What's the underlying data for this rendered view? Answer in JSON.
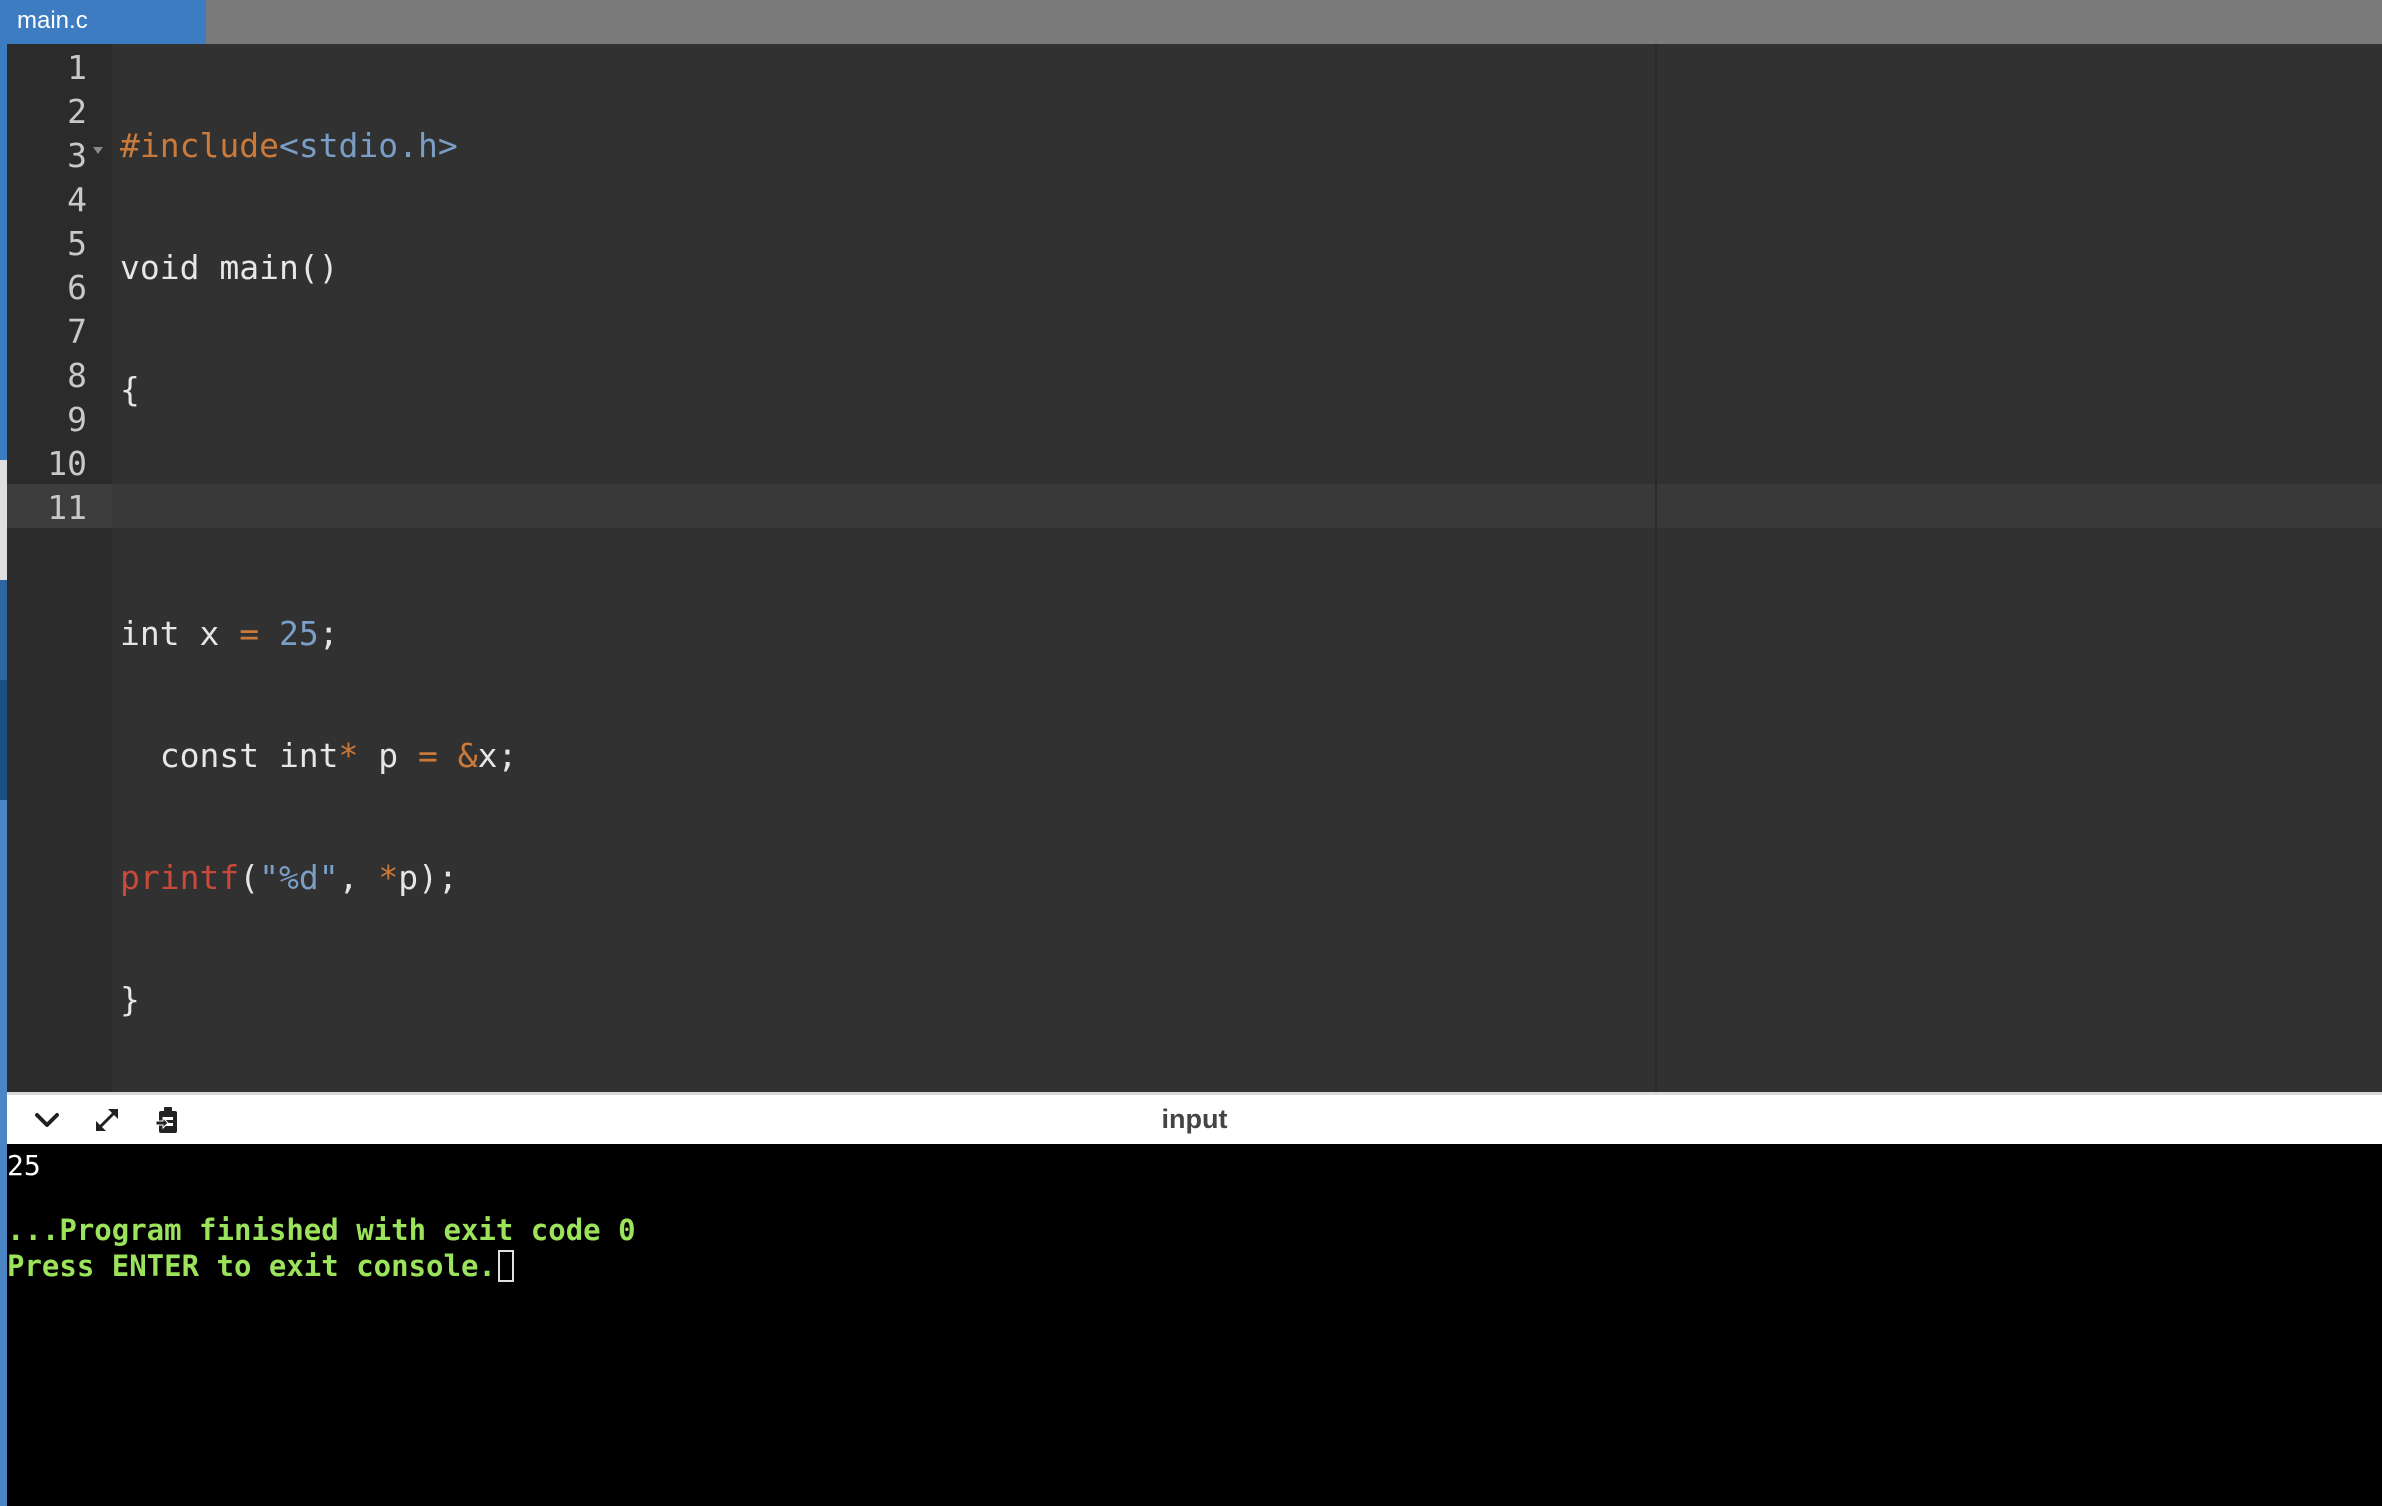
{
  "tabs": [
    {
      "label": "main.c",
      "active": true
    }
  ],
  "editor": {
    "line_numbers": [
      "1",
      "2",
      "3",
      "4",
      "5",
      "6",
      "7",
      "8",
      "9",
      "10",
      "11"
    ],
    "active_line": 11,
    "folded_line": 3
  },
  "code": {
    "l1": {
      "directive": "#include",
      "header": "<stdio.h>"
    },
    "l2": "void main()",
    "l3": "{",
    "l5": {
      "a": "int x ",
      "eq": "=",
      "b": " ",
      "num": "25",
      "c": ";"
    },
    "l6": {
      "a": "  const int",
      "star": "*",
      "b": " p ",
      "eq": "=",
      "c": " ",
      "amp": "&",
      "d": "x;"
    },
    "l7": {
      "fn": "printf",
      "a": "(",
      "fmt": "\"%d\"",
      "b": ", ",
      "star": "*",
      "c": "p);"
    },
    "l8": "}"
  },
  "console": {
    "title": "input",
    "output": "25",
    "status_line1": "...Program finished with exit code 0",
    "status_line2": "Press ENTER to exit console."
  },
  "icons": [
    "chevron-down-icon",
    "expand-icon",
    "clipboard-icon"
  ],
  "colors": {
    "tab_active": "#3e7cc2",
    "editor_bg": "#313131",
    "console_status": "#9be35a",
    "keyword": "#cc7a3a",
    "string": "#7a9ec5",
    "function": "#c94a3a"
  }
}
